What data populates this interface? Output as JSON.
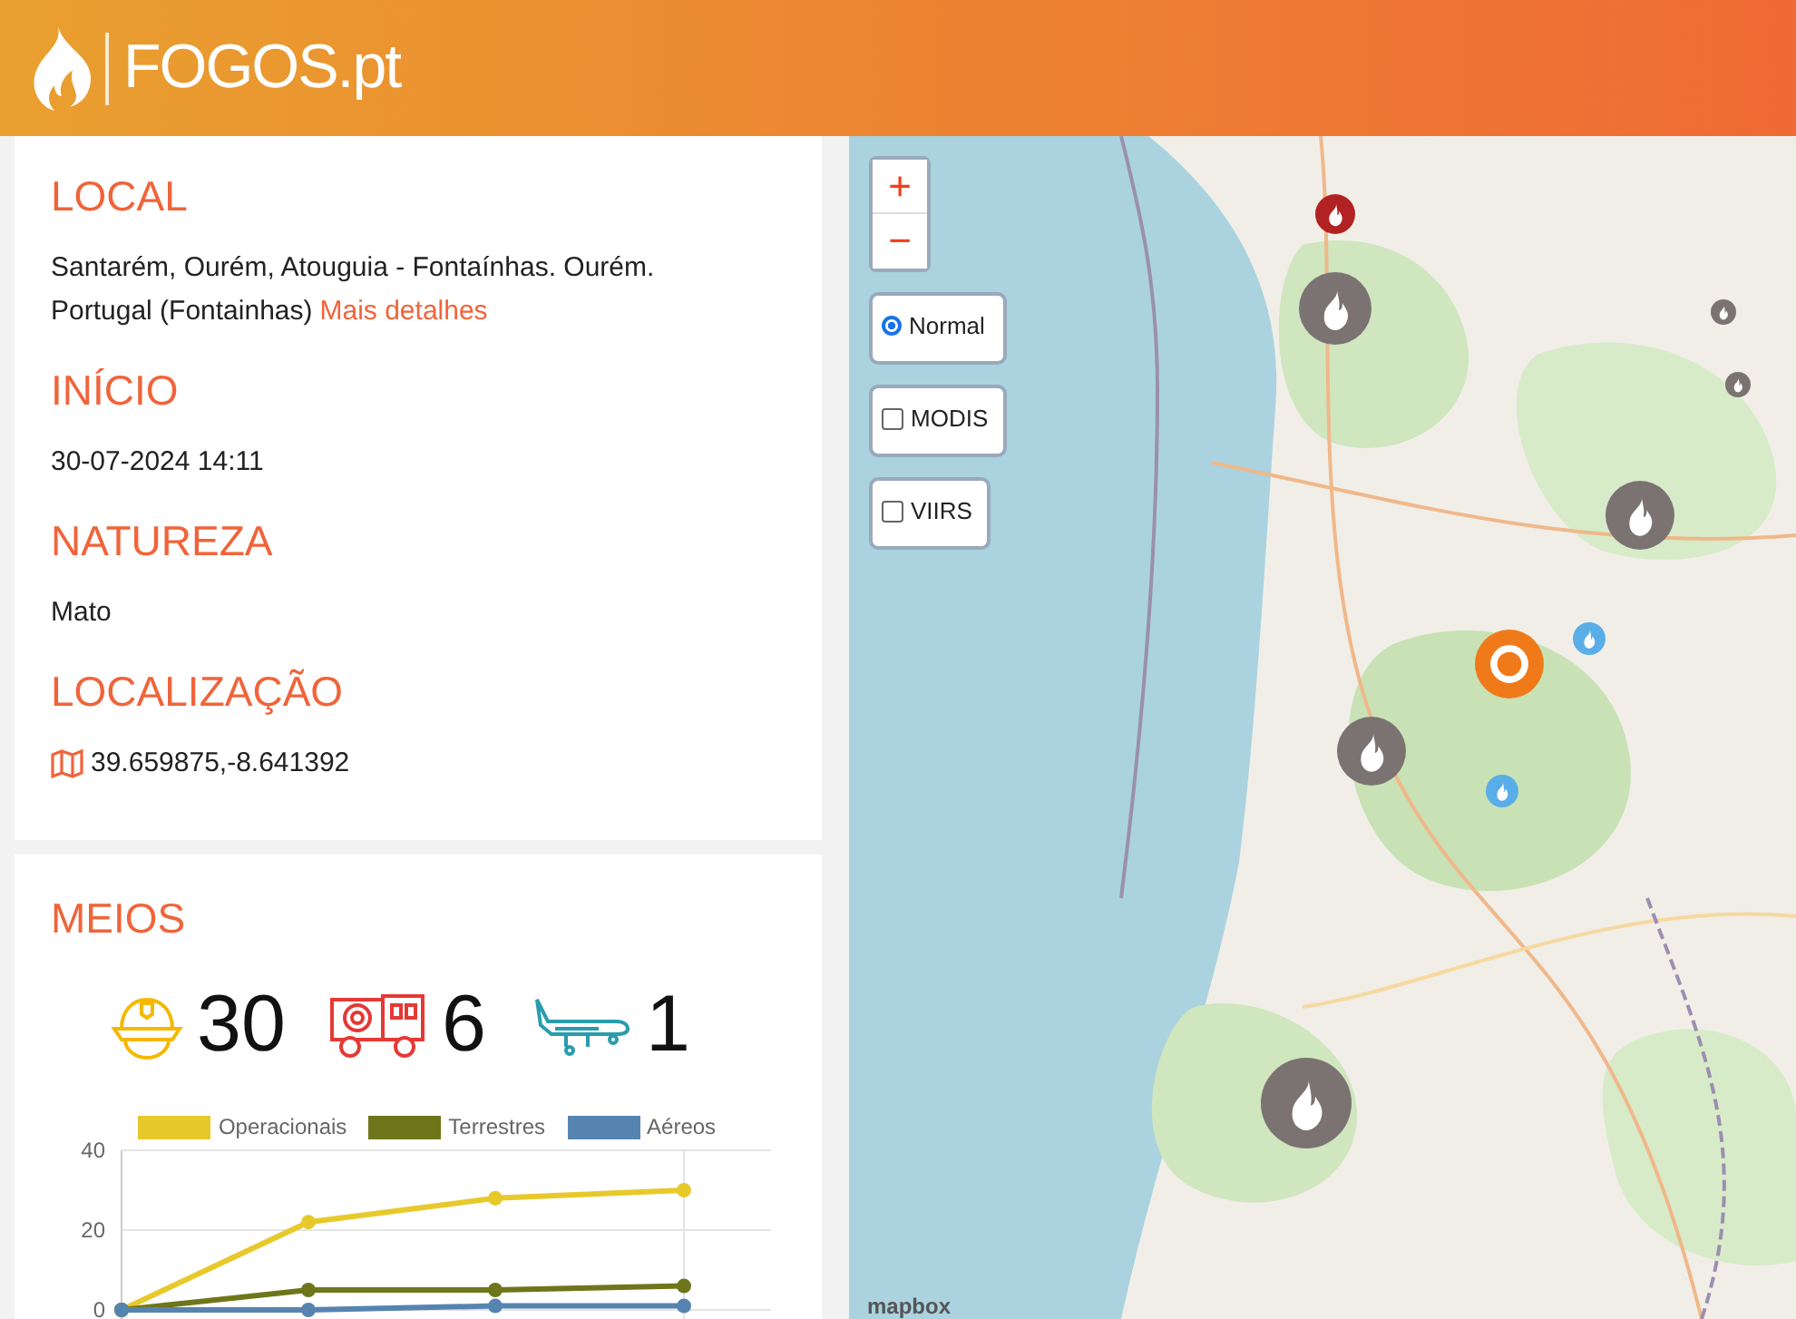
{
  "header": {
    "logo": "FOGOS.pt"
  },
  "details": [
    {
      "heading": "LOCAL",
      "text": "Santarém, Ourém, Atouguia - Fontaínhas. Ourém. Portugal (Fontainhas)",
      "link": "Mais detalhes"
    },
    {
      "heading": "INÍCIO",
      "text": "30-07-2024 14:11"
    },
    {
      "heading": "NATUREZA",
      "text": "Mato"
    },
    {
      "heading": "LOCALIZAÇÃO",
      "text": "39.659875,-8.641392",
      "kind": "coordinates"
    }
  ],
  "meios": {
    "heading": "MEIOS",
    "counts": [
      {
        "kind": "firefighters",
        "value": "30"
      },
      {
        "kind": "vehicles",
        "value": "6"
      },
      {
        "kind": "aircraft",
        "value": "1"
      }
    ],
    "chart_data": {
      "type": "line",
      "ylim": [
        0,
        40
      ],
      "yticks": [
        0,
        20,
        40
      ],
      "series": [
        {
          "name": "Operacionais",
          "color": "#e8c92b",
          "marker": true,
          "values": [
            0,
            22,
            28,
            30
          ]
        },
        {
          "name": "Terrestres",
          "color": "#6e761b",
          "marker": true,
          "values": [
            0,
            5,
            5,
            6
          ]
        },
        {
          "name": "Aéreos",
          "color": "#5684b0",
          "marker": true,
          "values": [
            0,
            0,
            1,
            1
          ]
        }
      ]
    }
  },
  "map": {
    "zoom": [
      "+",
      "−"
    ],
    "layers": [
      {
        "label": "Normal",
        "kind": "radio",
        "selected": true
      },
      {
        "label": "MODIS",
        "kind": "checkbox",
        "checked": false
      },
      {
        "label": "VIIRS",
        "kind": "checkbox",
        "checked": false
      }
    ],
    "attribution": "mapbox"
  }
}
